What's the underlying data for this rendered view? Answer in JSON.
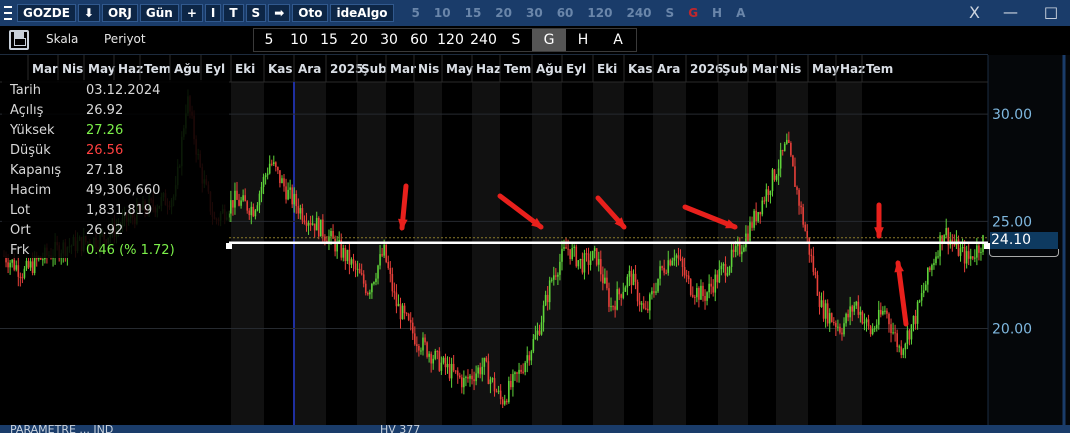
{
  "titlebar": {
    "symbol": "GOZDE",
    "down_arrow": "⬇",
    "orj": "ORJ",
    "period": "Gün",
    "plus": "+",
    "i": "I",
    "t": "T",
    "s": "S",
    "right_arrow": "➡",
    "oto": "Oto",
    "idealgo": "ideAlgo",
    "periods": [
      "5",
      "10",
      "15",
      "20",
      "30",
      "60",
      "120",
      "240",
      "S",
      "G",
      "H",
      "A"
    ],
    "close": "X",
    "minimize": "—",
    "maximize": "□"
  },
  "toolbar": {
    "scale": "Skala",
    "periyot": "Periyot",
    "periods": [
      "5",
      "10",
      "15",
      "20",
      "30",
      "60",
      "120",
      "240",
      "S",
      "G",
      "H",
      "A"
    ],
    "selected_period": "G"
  },
  "info_panel": {
    "rows": [
      {
        "key": "Tarih",
        "value": "03.12.2024",
        "tone": "white"
      },
      {
        "key": "Açılış",
        "value": "26.92",
        "tone": "white"
      },
      {
        "key": "Yüksek",
        "value": "27.26",
        "tone": "green"
      },
      {
        "key": "Düşük",
        "value": "26.56",
        "tone": "red"
      },
      {
        "key": "Kapanış",
        "value": "27.18",
        "tone": "white"
      },
      {
        "key": "Hacim",
        "value": "49,306,660",
        "tone": "white"
      },
      {
        "key": "Lot",
        "value": "1,831,819",
        "tone": "white"
      },
      {
        "key": "Ort",
        "value": "26.92",
        "tone": "white"
      },
      {
        "key": "Frk",
        "value": "0.46 (% 1.72)",
        "tone": "green"
      }
    ]
  },
  "price_tag": "24.10",
  "bottom": {
    "left": "PARAMETRE ... IND",
    "mid": "HV 377"
  },
  "colors": {
    "up": "#5fd43a",
    "down": "#e8403a",
    "axis": "#7fb8e0",
    "marker": "#e8201c",
    "titlebar": "#1a3c6a"
  },
  "chart_data": {
    "type": "candlestick",
    "x_months": [
      "Mar",
      "Nis",
      "May",
      "Haz",
      "Tem",
      "Ağu",
      "Eyl",
      "Eki",
      "Kas",
      "Ara",
      "2025",
      "Şub",
      "Mar",
      "Nis",
      "May",
      "Haz",
      "Tem",
      "Ağu",
      "Eyl",
      "Eki",
      "Kas",
      "Ara",
      "2026",
      "Şub",
      "Mar",
      "Nis",
      "May",
      "Haz",
      "Tem"
    ],
    "y_ticks": [
      "30.00",
      "25.00",
      "20.00"
    ],
    "ylim": [
      15.5,
      31.5
    ],
    "support_level": 24.0,
    "last_price": 24.1,
    "markers": [
      "down",
      "down-right",
      "down-right",
      "down-right",
      "down",
      "up"
    ],
    "price_path": [
      {
        "x": 0,
        "y": 23.4
      },
      {
        "x": 0.02,
        "y": 22.6
      },
      {
        "x": 0.035,
        "y": 23.2
      },
      {
        "x": 0.06,
        "y": 23.8
      },
      {
        "x": 0.1,
        "y": 24.2
      },
      {
        "x": 0.14,
        "y": 25.5
      },
      {
        "x": 0.175,
        "y": 26.2
      },
      {
        "x": 0.187,
        "y": 30.8
      },
      {
        "x": 0.2,
        "y": 27.5
      },
      {
        "x": 0.215,
        "y": 25.0
      },
      {
        "x": 0.235,
        "y": 26.0
      },
      {
        "x": 0.255,
        "y": 25.6
      },
      {
        "x": 0.272,
        "y": 27.8
      },
      {
        "x": 0.29,
        "y": 26.3
      },
      {
        "x": 0.305,
        "y": 25.4
      },
      {
        "x": 0.32,
        "y": 24.8
      },
      {
        "x": 0.335,
        "y": 24.1
      },
      {
        "x": 0.352,
        "y": 23.2
      },
      {
        "x": 0.372,
        "y": 21.8
      },
      {
        "x": 0.388,
        "y": 23.6
      },
      {
        "x": 0.4,
        "y": 21.2
      },
      {
        "x": 0.42,
        "y": 19.6
      },
      {
        "x": 0.445,
        "y": 18.4
      },
      {
        "x": 0.47,
        "y": 17.5
      },
      {
        "x": 0.49,
        "y": 18.3
      },
      {
        "x": 0.508,
        "y": 16.6
      },
      {
        "x": 0.525,
        "y": 17.8
      },
      {
        "x": 0.545,
        "y": 19.8
      },
      {
        "x": 0.56,
        "y": 22.4
      },
      {
        "x": 0.575,
        "y": 23.8
      },
      {
        "x": 0.59,
        "y": 23.0
      },
      {
        "x": 0.605,
        "y": 23.4
      },
      {
        "x": 0.62,
        "y": 21.0
      },
      {
        "x": 0.64,
        "y": 22.5
      },
      {
        "x": 0.655,
        "y": 20.6
      },
      {
        "x": 0.67,
        "y": 22.6
      },
      {
        "x": 0.685,
        "y": 23.6
      },
      {
        "x": 0.7,
        "y": 22.0
      },
      {
        "x": 0.715,
        "y": 21.5
      },
      {
        "x": 0.735,
        "y": 22.8
      },
      {
        "x": 0.75,
        "y": 23.6
      },
      {
        "x": 0.765,
        "y": 25.0
      },
      {
        "x": 0.785,
        "y": 27.0
      },
      {
        "x": 0.8,
        "y": 28.6
      },
      {
        "x": 0.81,
        "y": 26.4
      },
      {
        "x": 0.82,
        "y": 24.2
      },
      {
        "x": 0.835,
        "y": 21.0
      },
      {
        "x": 0.855,
        "y": 20.0
      },
      {
        "x": 0.87,
        "y": 21.2
      },
      {
        "x": 0.885,
        "y": 19.8
      },
      {
        "x": 0.9,
        "y": 20.9
      },
      {
        "x": 0.915,
        "y": 19.0
      },
      {
        "x": 0.93,
        "y": 20.4
      },
      {
        "x": 0.945,
        "y": 22.6
      },
      {
        "x": 0.96,
        "y": 24.6
      },
      {
        "x": 0.972,
        "y": 23.8
      },
      {
        "x": 0.985,
        "y": 23.2
      },
      {
        "x": 1.0,
        "y": 24.1
      }
    ]
  }
}
